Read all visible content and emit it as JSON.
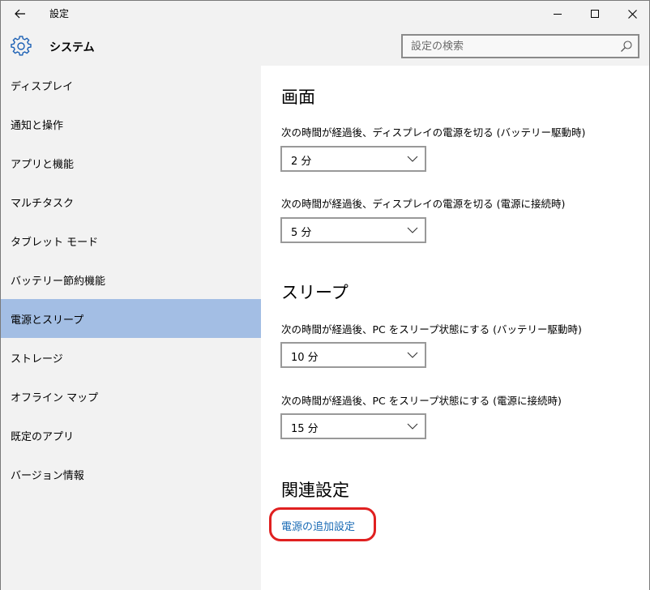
{
  "titlebar": {
    "title": "設定"
  },
  "header": {
    "title": "システム",
    "search_placeholder": "設定の検索"
  },
  "sidebar": {
    "items": [
      {
        "label": "ディスプレイ"
      },
      {
        "label": "通知と操作"
      },
      {
        "label": "アプリと機能"
      },
      {
        "label": "マルチタスク"
      },
      {
        "label": "タブレット モード"
      },
      {
        "label": "バッテリー節約機能"
      },
      {
        "label": "電源とスリープ"
      },
      {
        "label": "ストレージ"
      },
      {
        "label": "オフライン マップ"
      },
      {
        "label": "既定のアプリ"
      },
      {
        "label": "バージョン情報"
      }
    ],
    "active_index": 6
  },
  "content": {
    "screen_heading": "画面",
    "screen_battery_label": "次の時間が経過後、ディスプレイの電源を切る (バッテリー駆動時)",
    "screen_battery_value": "2 分",
    "screen_plugged_label": "次の時間が経過後、ディスプレイの電源を切る (電源に接続時)",
    "screen_plugged_value": "5 分",
    "sleep_heading": "スリープ",
    "sleep_battery_label": "次の時間が経過後、PC をスリープ状態にする (バッテリー駆動時)",
    "sleep_battery_value": "10 分",
    "sleep_plugged_label": "次の時間が経過後、PC をスリープ状態にする (電源に接続時)",
    "sleep_plugged_value": "15 分",
    "related_heading": "関連設定",
    "related_link": "電源の追加設定"
  },
  "colors": {
    "active_item": "#a3bee4",
    "link": "#1a6bb5",
    "highlight_circle": "#e02020"
  }
}
